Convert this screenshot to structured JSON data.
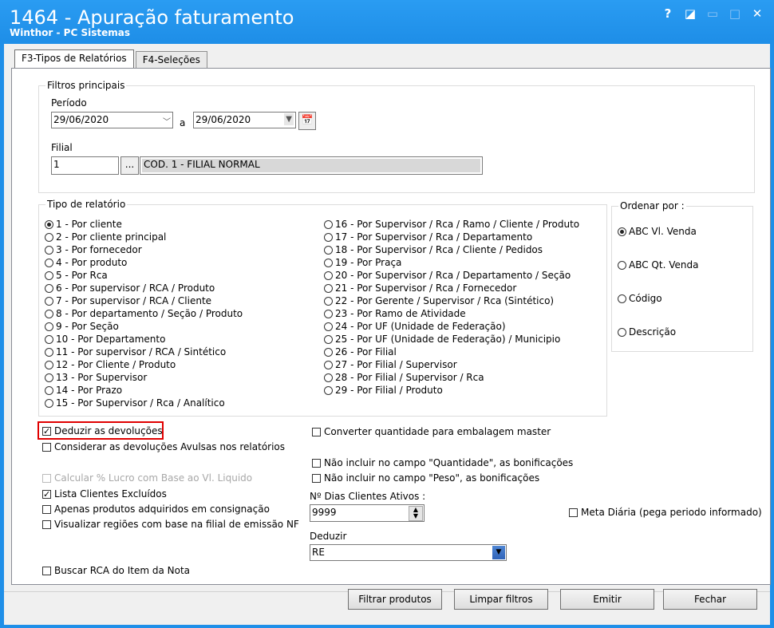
{
  "window": {
    "title": "1464 - Apuração faturamento",
    "subtitle": "Winthor - PC Sistemas",
    "help_icon": "?",
    "restore_icon": "◪",
    "close_icon": "✕"
  },
  "tabs": [
    {
      "label": "F3-Tipos de Relatórios"
    },
    {
      "label": "F4-Seleções"
    }
  ],
  "filtros": {
    "title": "Filtros principais",
    "periodo_label": "Período",
    "date_from": "29/06/2020",
    "a_label": "a",
    "date_to": "29/06/2020",
    "filial_label": "Filial",
    "filial_code": "1",
    "filial_lookup": "...",
    "filial_name": "COD. 1 - FILIAL NORMAL"
  },
  "tipo": {
    "title": "Tipo de relatório",
    "col1": [
      "1 - Por cliente",
      "2 - Por cliente principal",
      "3 - Por fornecedor",
      "4 - Por produto",
      "5 - Por Rca",
      "6 - Por supervisor / RCA / Produto",
      "7 - Por supervisor / RCA / Cliente",
      "8 - Por departamento / Seção / Produto",
      "9 - Por Seção",
      "10 - Por Departamento",
      "11 - Por supervisor / RCA / Sintético",
      "12 - Por Cliente / Produto",
      "13 - Por Supervisor",
      "14 - Por Prazo",
      "15 - Por Supervisor / Rca / Analítico"
    ],
    "col2": [
      "16 - Por Supervisor / Rca / Ramo /  Cliente / Produto",
      "17 - Por Supervisor / Rca / Departamento",
      "18 - Por Supervisor / Rca / Cliente / Pedidos",
      "19 - Por Praça",
      "20 - Por Supervisor / Rca / Departamento / Seção",
      "21 - Por Supervisor / Rca / Fornecedor",
      "22 - Por Gerente / Supervisor / Rca (Sintético)",
      "23 - Por Ramo de Atividade",
      "24 - Por UF (Unidade de Federação)",
      "25 - Por UF (Unidade de Federação) / Municipio",
      "26 - Por Filial",
      "27 - Por Filial / Supervisor",
      "28 - Por Filial / Supervisor / Rca",
      "29 - Por Filial / Produto"
    ],
    "selected": "1 - Por cliente"
  },
  "ordenar": {
    "title": "Ordenar por :",
    "options": [
      "ABC Vl. Venda",
      "ABC Qt. Venda",
      "Código",
      "Descrição"
    ],
    "selected": "ABC Vl. Venda"
  },
  "checks": {
    "deduzir_devolucoes": "Deduzir as devoluções",
    "considerar_avulsas": "Considerar as devoluções Avulsas nos relatórios",
    "calcular_lucro": "Calcular % Lucro com Base ao Vl. Liquido",
    "lista_clientes": "Lista Clientes Excluídos",
    "apenas_consignacao": "Apenas produtos adquiridos em consignação",
    "visualizar_regioes": "Visualizar regiões com base na filial de emissão NF",
    "buscar_rca": "Buscar RCA do Item da Nota",
    "converter_qtd": "Converter quantidade para embalagem master",
    "nao_incluir_qtd": "Não incluir no campo \"Quantidade\", as bonificações",
    "nao_incluir_peso": "Não incluir no campo \"Peso\", as bonificações",
    "meta_diaria": "Meta Diária (pega periodo informado)",
    "check_mark": "✓"
  },
  "dias": {
    "label": "Nº Dias Clientes Ativos :",
    "value": "9999"
  },
  "deduzir": {
    "label": "Deduzir",
    "value": "RE"
  },
  "buttons": {
    "filtrar": "Filtrar produtos",
    "limpar": "Limpar filtros",
    "emitir": "Emitir",
    "fechar": "Fechar"
  }
}
